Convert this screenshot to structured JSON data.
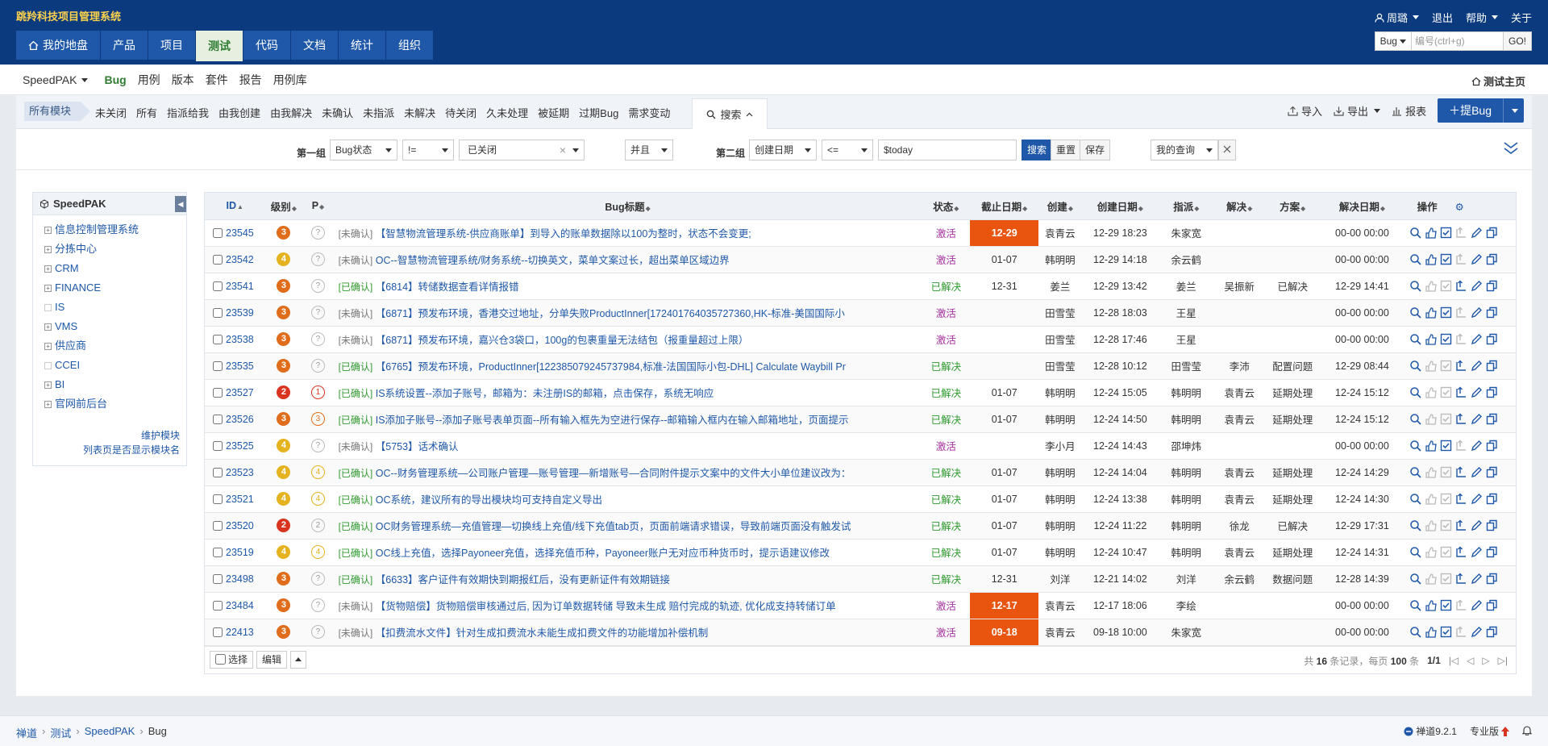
{
  "app": {
    "brand": "跳羚科技项目管理系统"
  },
  "user": {
    "name": "周璐",
    "logout": "退出",
    "help": "帮助",
    "about": "关于"
  },
  "nav": [
    {
      "label": "我的地盘",
      "icon": "home-icon"
    },
    {
      "label": "产品"
    },
    {
      "label": "项目"
    },
    {
      "label": "测试",
      "active": true
    },
    {
      "label": "代码"
    },
    {
      "label": "文档"
    },
    {
      "label": "统计"
    },
    {
      "label": "组织"
    }
  ],
  "globalsearch": {
    "type": "Bug",
    "placeholder": "编号(ctrl+g)",
    "go": "GO!"
  },
  "subnav": {
    "product": "SpeedPAK",
    "items": [
      "Bug",
      "用例",
      "版本",
      "套件",
      "报告",
      "用例库"
    ],
    "home": "测试主页"
  },
  "featurebar": {
    "module": "所有模块",
    "filters": [
      "未关闭",
      "所有",
      "指派给我",
      "由我创建",
      "由我解决",
      "未确认",
      "未指派",
      "未解决",
      "待关闭",
      "久未处理",
      "被延期",
      "过期Bug",
      "需求变动"
    ],
    "search": "搜索",
    "import": "导入",
    "export": "导出",
    "report": "报表",
    "create": "提Bug"
  },
  "searchform": {
    "group1": "第一组",
    "field1": "Bug状态",
    "op1": "!=",
    "value1": "已关闭",
    "andor": "并且",
    "group2": "第二组",
    "field2": "创建日期",
    "op2": "<=",
    "value2": "$today",
    "search": "搜索",
    "reset": "重置",
    "save": "保存",
    "myquery": "我的查询"
  },
  "tree": {
    "title": "SpeedPAK",
    "items": [
      {
        "label": "信息控制管理系统",
        "expand": true
      },
      {
        "label": "分拣中心",
        "expand": true
      },
      {
        "label": "CRM",
        "expand": true
      },
      {
        "label": "FINANCE",
        "expand": true
      },
      {
        "label": "IS",
        "expand": false
      },
      {
        "label": "VMS",
        "expand": true
      },
      {
        "label": "供应商",
        "expand": true
      },
      {
        "label": "CCEI",
        "expand": false
      },
      {
        "label": "BI",
        "expand": true
      },
      {
        "label": "官网前后台",
        "expand": true
      }
    ],
    "maintain": "维护模块",
    "showmodule": "列表页是否显示模块名"
  },
  "table": {
    "headers": [
      "ID",
      "级别",
      "P",
      "Bug标题",
      "状态",
      "截止日期",
      "创建",
      "创建日期",
      "指派",
      "解决",
      "方案",
      "解决日期",
      "操作"
    ],
    "rows": [
      {
        "id": "23545",
        "sev": "3",
        "pri": "?",
        "conf": "[未确认]",
        "confirmed": false,
        "title": "【智慧物流管理系统-供应商账单】到导入的账单数据除以100为整时，状态不会变更;",
        "status": "激活",
        "deadline": "12-29",
        "overdue": true,
        "creator": "袁青云",
        "created": "12-29 18:23",
        "assigned": "朱家宽",
        "resolver": "",
        "solution": "",
        "resolved": "00-00 00:00"
      },
      {
        "id": "23542",
        "sev": "4",
        "pri": "?",
        "conf": "[未确认]",
        "confirmed": false,
        "title": "OC--智慧物流管理系统/财务系统--切换英文，菜单文案过长，超出菜单区域边界",
        "status": "激活",
        "deadline": "01-07",
        "overdue": false,
        "creator": "韩明明",
        "created": "12-29 14:18",
        "assigned": "余云鹤",
        "resolver": "",
        "solution": "",
        "resolved": "00-00 00:00"
      },
      {
        "id": "23541",
        "sev": "3",
        "pri": "?",
        "conf": "[已确认]",
        "confirmed": true,
        "title": "【6814】转储数据查看详情报错",
        "status": "已解决",
        "deadline": "12-31",
        "overdue": false,
        "creator": "姜兰",
        "created": "12-29 13:42",
        "assigned": "姜兰",
        "resolver": "吴振新",
        "solution": "已解决",
        "resolved": "12-29 14:41"
      },
      {
        "id": "23539",
        "sev": "3",
        "pri": "?",
        "conf": "[未确认]",
        "confirmed": false,
        "title": "【6871】预发布环境，香港交过地址，分单失败ProductInner[172401764035727360,HK-标准-美国国际小",
        "status": "激活",
        "deadline": "",
        "overdue": false,
        "creator": "田雪莹",
        "created": "12-28 18:03",
        "assigned": "王星",
        "resolver": "",
        "solution": "",
        "resolved": "00-00 00:00"
      },
      {
        "id": "23538",
        "sev": "3",
        "pri": "?",
        "conf": "[未确认]",
        "confirmed": false,
        "title": "【6871】预发布环境，嘉兴仓3袋口，100g的包裹重量无法结包（报重量超过上限）",
        "status": "激活",
        "deadline": "",
        "overdue": false,
        "creator": "田雪莹",
        "created": "12-28 17:46",
        "assigned": "王星",
        "resolver": "",
        "solution": "",
        "resolved": "00-00 00:00"
      },
      {
        "id": "23535",
        "sev": "3",
        "pri": "?",
        "conf": "[已确认]",
        "confirmed": true,
        "title": "【6765】预发布环境，ProductInner[122385079245737984,标准-法国国际小包-DHL] Calculate Waybill Pr",
        "status": "已解决",
        "deadline": "",
        "overdue": false,
        "creator": "田雪莹",
        "created": "12-28 10:12",
        "assigned": "田雪莹",
        "resolver": "李沛",
        "solution": "配置问题",
        "resolved": "12-29 08:44"
      },
      {
        "id": "23527",
        "sev": "2",
        "pri": "1",
        "conf": "[已确认]",
        "confirmed": true,
        "title": "IS系统设置--添加子账号，邮箱为：未注册IS的邮箱，点击保存，系统无响应",
        "status": "已解决",
        "deadline": "01-07",
        "overdue": false,
        "creator": "韩明明",
        "created": "12-24 15:05",
        "assigned": "韩明明",
        "resolver": "袁青云",
        "solution": "延期处理",
        "resolved": "12-24 15:12"
      },
      {
        "id": "23526",
        "sev": "3",
        "pri": "3",
        "conf": "[已确认]",
        "confirmed": true,
        "title": "IS添加子账号--添加子账号表单页面--所有输入框先为空进行保存--邮箱输入框内在输入邮箱地址，页面提示",
        "status": "已解决",
        "deadline": "01-07",
        "overdue": false,
        "creator": "韩明明",
        "created": "12-24 14:50",
        "assigned": "韩明明",
        "resolver": "袁青云",
        "solution": "延期处理",
        "resolved": "12-24 15:12"
      },
      {
        "id": "23525",
        "sev": "4",
        "pri": "?",
        "conf": "[未确认]",
        "confirmed": false,
        "title": "【5753】话术确认",
        "status": "激活",
        "deadline": "",
        "overdue": false,
        "creator": "李小月",
        "created": "12-24 14:43",
        "assigned": "邵坤炜",
        "resolver": "",
        "solution": "",
        "resolved": "00-00 00:00"
      },
      {
        "id": "23523",
        "sev": "4",
        "pri": "4",
        "conf": "[已确认]",
        "confirmed": true,
        "title": "OC--财务管理系统—公司账户管理—账号管理—新增账号—合同附件提示文案中的文件大小单位建议改为：",
        "status": "已解决",
        "deadline": "01-07",
        "overdue": false,
        "creator": "韩明明",
        "created": "12-24 14:04",
        "assigned": "韩明明",
        "resolver": "袁青云",
        "solution": "延期处理",
        "resolved": "12-24 14:29"
      },
      {
        "id": "23521",
        "sev": "4",
        "pri": "4",
        "conf": "[已确认]",
        "confirmed": true,
        "title": "OC系统，建议所有的导出模块均可支持自定义导出",
        "status": "已解决",
        "deadline": "01-07",
        "overdue": false,
        "creator": "韩明明",
        "created": "12-24 13:38",
        "assigned": "韩明明",
        "resolver": "袁青云",
        "solution": "延期处理",
        "resolved": "12-24 14:30"
      },
      {
        "id": "23520",
        "sev": "2",
        "pri": "2",
        "conf": "[已确认]",
        "confirmed": true,
        "title": "OC财务管理系统—充值管理—切换线上充值/线下充值tab页，页面前端请求错误，导致前端页面没有触发试",
        "status": "已解决",
        "deadline": "01-07",
        "overdue": false,
        "creator": "韩明明",
        "created": "12-24 11:22",
        "assigned": "韩明明",
        "resolver": "徐龙",
        "solution": "已解决",
        "resolved": "12-29 17:31"
      },
      {
        "id": "23519",
        "sev": "4",
        "pri": "4",
        "conf": "[已确认]",
        "confirmed": true,
        "title": "OC线上充值，选择Payoneer充值，选择充值币种，Payoneer账户无对应币种货币时，提示语建议修改",
        "status": "已解决",
        "deadline": "01-07",
        "overdue": false,
        "creator": "韩明明",
        "created": "12-24 10:47",
        "assigned": "韩明明",
        "resolver": "袁青云",
        "solution": "延期处理",
        "resolved": "12-24 14:31"
      },
      {
        "id": "23498",
        "sev": "3",
        "pri": "?",
        "conf": "[已确认]",
        "confirmed": true,
        "title": "【6633】客户证件有效期快到期报红后，没有更新证件有效期链接",
        "status": "已解决",
        "deadline": "12-31",
        "overdue": false,
        "creator": "刘洋",
        "created": "12-21 14:02",
        "assigned": "刘洋",
        "resolver": "余云鹤",
        "solution": "数据问题",
        "resolved": "12-28 14:39"
      },
      {
        "id": "23484",
        "sev": "3",
        "pri": "?",
        "conf": "[未确认]",
        "confirmed": false,
        "title": "【货物赔偿】货物赔偿审核通过后, 因为订单数据转储 导致未生成 赔付完成的轨迹, 优化成支持转储订单",
        "status": "激活",
        "deadline": "12-17",
        "overdue": true,
        "creator": "袁青云",
        "created": "12-17 18:06",
        "assigned": "李绘",
        "resolver": "",
        "solution": "",
        "resolved": "00-00 00:00"
      },
      {
        "id": "22413",
        "sev": "3",
        "pri": "?",
        "conf": "[未确认]",
        "confirmed": false,
        "title": "【扣费流水文件】针对生成扣费流水未能生成扣费文件的功能增加补偿机制",
        "status": "激活",
        "deadline": "09-18",
        "overdue": true,
        "creator": "袁青云",
        "created": "09-18 10:00",
        "assigned": "朱家宽",
        "resolver": "",
        "solution": "",
        "resolved": "00-00 00:00"
      }
    ],
    "select": "选择",
    "edit": "编辑",
    "pager": {
      "total_prefix": "共",
      "total": "16",
      "total_suffix": "条记录，",
      "per_prefix": "每页",
      "per": "100",
      "per_suffix": "条",
      "page": "1/1"
    }
  },
  "footer": {
    "crumbs": [
      "禅道",
      "测试",
      "SpeedPAK",
      "Bug"
    ],
    "version": "禅道9.2.1",
    "edition": "专业版"
  },
  "colors": {
    "header": "#0b3a7e",
    "accent": "#1f58a8",
    "overdue": "#e9540f",
    "active_status": "#a62fa0",
    "resolved_status": "#2f9a2f"
  }
}
